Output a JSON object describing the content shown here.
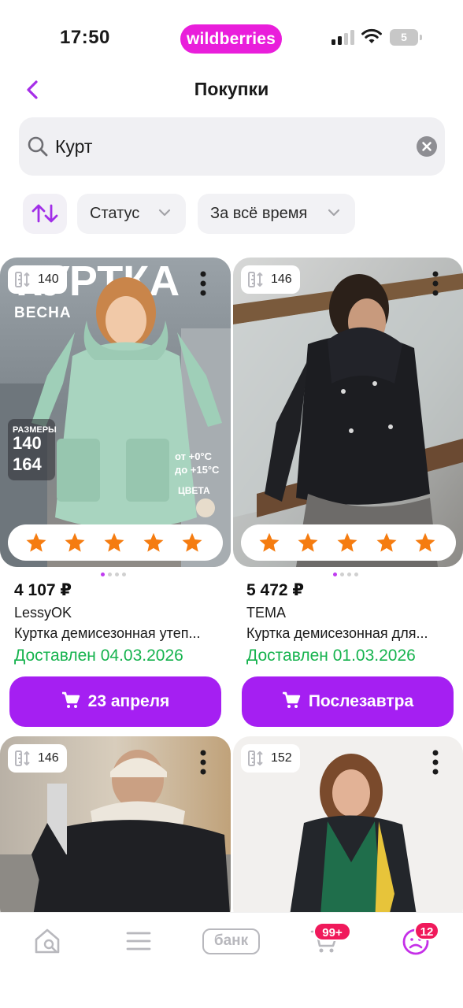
{
  "status_bar": {
    "time": "17:50",
    "brand": "wildberries",
    "battery": "5"
  },
  "header": {
    "title": "Покупки"
  },
  "search": {
    "value": "Курт"
  },
  "filters": {
    "status": "Статус",
    "period": "За всё время"
  },
  "products": [
    {
      "size": "140",
      "rating": 5,
      "price": "4 107 ₽",
      "brand": "LessyOK",
      "name": "Куртка демисезонная утеп...",
      "delivered": "Доставлен 04.03.2026",
      "action": "23 апреля",
      "photo_text": {
        "headline": "КУРТКА",
        "season": "ВЕСНА",
        "sizes_label": "РАЗМЕРЫ",
        "size_from": "140",
        "size_to": "164",
        "temp_from": "от +0°C",
        "temp_to": "до +15°C",
        "colors_label": "ЦВЕТА"
      }
    },
    {
      "size": "146",
      "rating": 5,
      "price": "5 472 ₽",
      "brand": "TEMA",
      "name": "Куртка демисезонная для...",
      "delivered": "Доставлен 01.03.2026",
      "action": "Послезавтра"
    },
    {
      "size": "146"
    },
    {
      "size": "152"
    }
  ],
  "bottom_nav": {
    "bank_label": "банк",
    "cart_badge": "99+",
    "profile_badge": "12"
  },
  "colors": {
    "brand_pink": "#e91edb",
    "accent_purple": "#a51ff2",
    "delivered_green": "#16b34e",
    "rating_orange": "#f57c10",
    "badge_red": "#f0195b"
  },
  "icons": {
    "back": "chevron-left-icon",
    "search": "search-icon",
    "clear": "clear-icon",
    "sort": "sort-icon",
    "size": "ruler-icon",
    "more": "more-vertical-icon",
    "cart": "cart-icon",
    "home": "home-search-icon",
    "catalog": "menu-icon",
    "profile": "profile-icon"
  }
}
